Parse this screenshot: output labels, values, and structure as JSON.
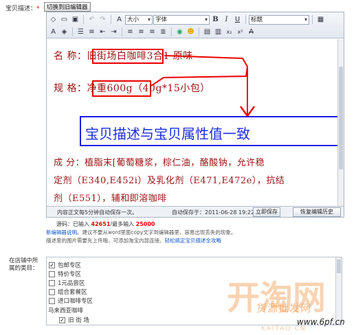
{
  "form": {
    "desc_label": "宝贝描述：",
    "required_mark": "*",
    "switch_button": "切换到旧编辑器"
  },
  "toolbar": {
    "font_size": "大小",
    "font_family": "字体",
    "heading": "标题"
  },
  "content": {
    "line1_label": "名  称：",
    "line1_value": "旧街场白咖啡3合1 原味",
    "line2_label": "规  格：",
    "line2_value": "净重600g（40g*15小包）",
    "annotation": "宝贝描述与宝贝属性值一致",
    "line3": "成 分：植脂末[葡萄糖浆，棕仁油，酪酸钠，允许稳",
    "line4": "定剂（E340,E452i）及乳化剂（E471,E472e），抗结",
    "line5": "剂（E551），辅和即溶咖啡"
  },
  "status": {
    "autosave_text": "内容正文每5分钟自动保存一次。",
    "autosave_time": "自动保存于：2011-06-28 19:22:38",
    "save_button": "立即保存",
    "restore_button": "恢复编辑历史"
  },
  "counter": {
    "prefix": "源码：已输入 ",
    "typed": "42651",
    "middle": "/最多输入 ",
    "max": "25000"
  },
  "tips": {
    "line1_link": "新编辑器说明",
    "line1_text": "。建议不要从word里面copy文字到编辑器里，容易出现丢失的现象。",
    "line2_text": "描述里的图片需要先上传哦，可添加淘宝内部连接。",
    "line2_link": "轻松搞定宝贝描述全攻略"
  },
  "category": {
    "label": "在店铺中所属的类目：",
    "items": [
      "包邮专区",
      "特价专区",
      "1元品尝区",
      "组合套餐区",
      "进口咖啡专区"
    ],
    "checked": [
      true,
      false,
      false,
      false,
      false
    ],
    "group_name": "马来西亚咖啡",
    "sub_item": "旧 街 场",
    "sub_checked": true
  },
  "watermark": {
    "logo": "开淘网",
    "sub": "货源批发网",
    "site": "www.6pf.cn",
    "kaitao": "KAITAO.CN"
  },
  "colors": {
    "content_text": "#9b1212",
    "annotation_box": "#1a1ae6",
    "highlight_box": "#ee0000",
    "link": "#1155cc"
  }
}
